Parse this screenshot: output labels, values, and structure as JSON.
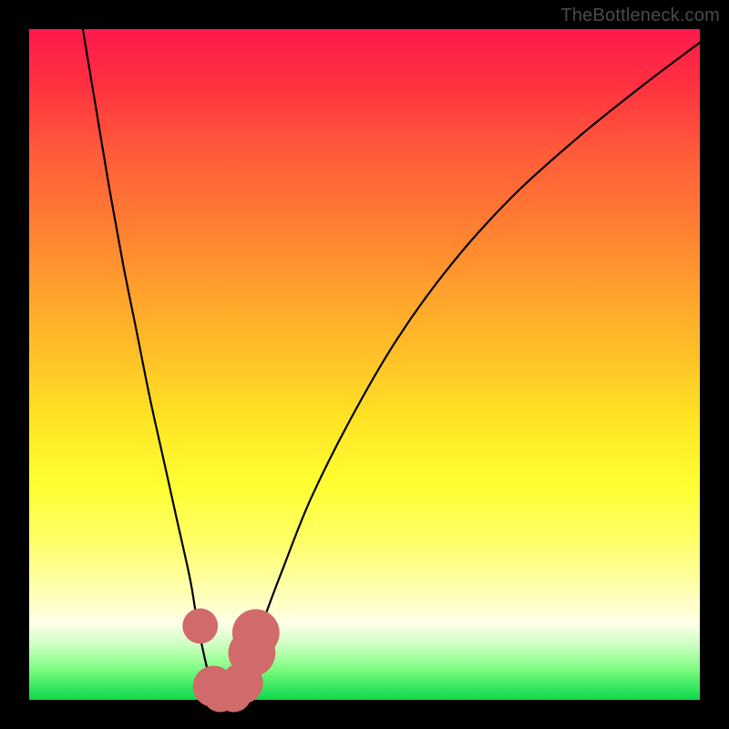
{
  "watermark": "TheBottleneck.com",
  "chart_data": {
    "type": "line",
    "title": "",
    "xlabel": "",
    "ylabel": "",
    "xlim": [
      0,
      100
    ],
    "ylim": [
      0,
      100
    ],
    "gradient_stops": [
      {
        "pos": 0,
        "color": "#ff1a4d"
      },
      {
        "pos": 18,
        "color": "#ff5a3a"
      },
      {
        "pos": 38,
        "color": "#ff9d2d"
      },
      {
        "pos": 58,
        "color": "#ffe324"
      },
      {
        "pos": 76,
        "color": "#ffff66"
      },
      {
        "pos": 88,
        "color": "#ffffe0"
      },
      {
        "pos": 94,
        "color": "#a0ff9c"
      },
      {
        "pos": 100,
        "color": "#10d84a"
      }
    ],
    "series": [
      {
        "name": "bottleneck-curve",
        "stroke": "#000000",
        "x": [
          8,
          10,
          12,
          14,
          16,
          18,
          20,
          22,
          24,
          25,
          26,
          27,
          28,
          29,
          30,
          31,
          32,
          33,
          35,
          38,
          42,
          48,
          55,
          63,
          72,
          82,
          92,
          100
        ],
        "values": [
          100,
          88,
          76,
          65,
          55,
          45,
          36,
          27,
          18,
          12,
          7,
          3,
          1,
          0,
          0,
          1,
          3,
          6,
          12,
          20,
          30,
          42,
          54,
          65,
          75,
          84,
          92,
          98
        ]
      }
    ],
    "markers": [
      {
        "name": "marker-left",
        "x": 25.5,
        "y": 11,
        "r": 1.2,
        "color": "#d16a6a"
      },
      {
        "name": "marker-min-a",
        "x": 27.5,
        "y": 2.0,
        "r": 1.4,
        "color": "#d16a6a"
      },
      {
        "name": "marker-min-b",
        "x": 28.5,
        "y": 0.8,
        "r": 1.2,
        "color": "#d16a6a"
      },
      {
        "name": "marker-min-c",
        "x": 30.5,
        "y": 0.8,
        "r": 1.2,
        "color": "#d16a6a"
      },
      {
        "name": "marker-min-d",
        "x": 31.8,
        "y": 2.5,
        "r": 1.4,
        "color": "#d16a6a"
      },
      {
        "name": "marker-right-a",
        "x": 33.2,
        "y": 7.0,
        "r": 1.6,
        "color": "#d16a6a"
      },
      {
        "name": "marker-right-b",
        "x": 33.8,
        "y": 10.0,
        "r": 1.6,
        "color": "#d16a6a"
      }
    ]
  }
}
